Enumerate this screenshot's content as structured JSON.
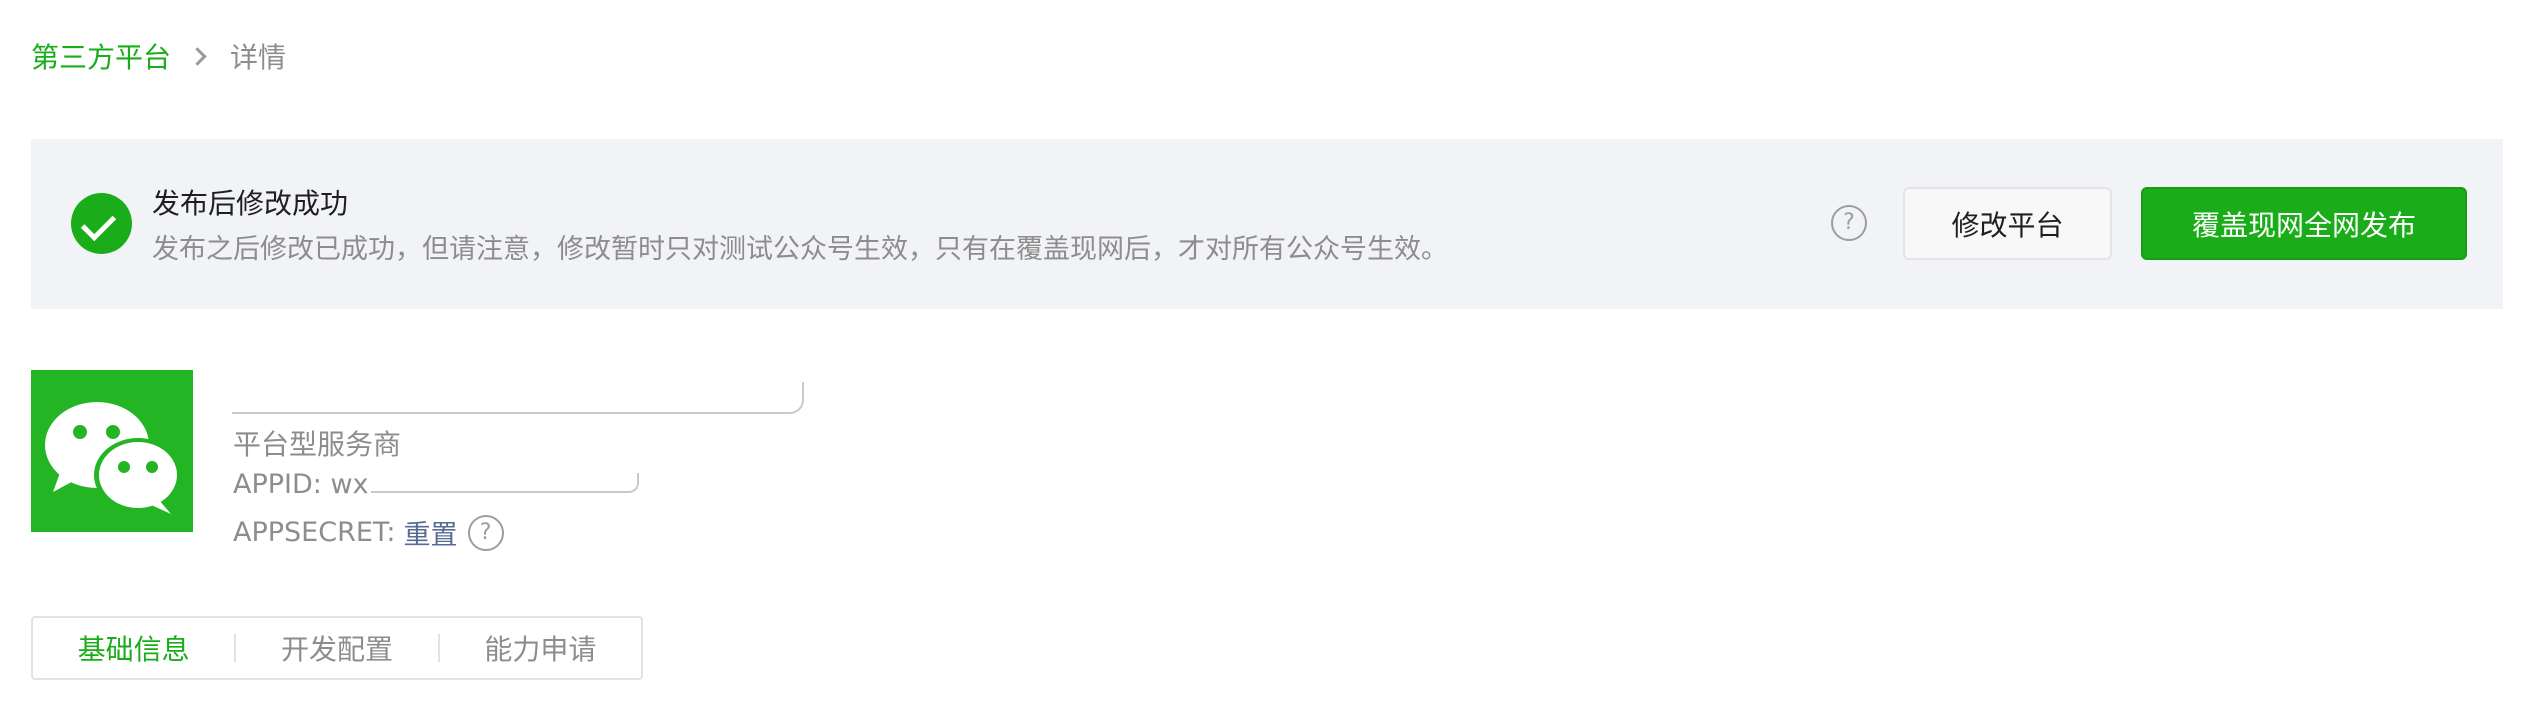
{
  "breadcrumb": {
    "parent": "第三方平台",
    "current": "详情"
  },
  "notice": {
    "title": "发布后修改成功",
    "description": "发布之后修改已成功，但请注意，修改暂时只对测试公众号生效，只有在覆盖现网后，才对所有公众号生效。",
    "help_symbol": "?",
    "modify_button": "修改平台",
    "publish_button": "覆盖现网全网发布"
  },
  "app": {
    "type": "平台型服务商",
    "appid_label": "APPID: wx",
    "appsecret_label": "APPSECRET:",
    "reset_link": "重置",
    "help_symbol": "?"
  },
  "tabs": [
    {
      "label": "基础信息",
      "active": true
    },
    {
      "label": "开发配置",
      "active": false
    },
    {
      "label": "能力申请",
      "active": false
    }
  ],
  "colors": {
    "brand_green": "#1AAD19",
    "link_blue": "#576b95",
    "notice_bg": "#f2f3f6"
  },
  "icons": {
    "logo": "wechat-logo-icon",
    "success": "success-check-icon",
    "help": "question-circle-icon",
    "breadcrumb_separator": "chevron-right-icon"
  }
}
